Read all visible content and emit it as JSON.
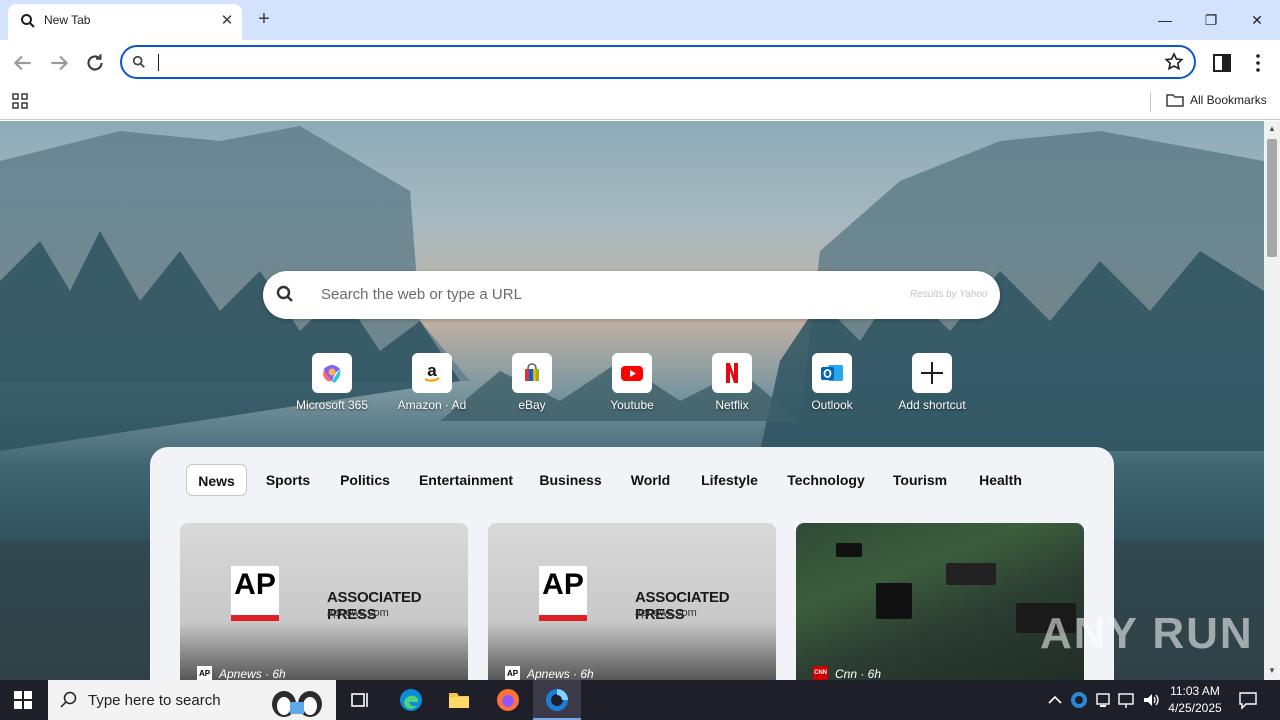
{
  "browser": {
    "tab": {
      "title": "New Tab",
      "icon": "search-icon"
    },
    "window_controls": [
      "minimize-icon",
      "restore-icon",
      "close-icon"
    ],
    "omnibox": {
      "value": "",
      "placeholder": ""
    },
    "bookmarks": {
      "folder_label": "All Bookmarks"
    }
  },
  "page": {
    "search": {
      "placeholder": "Search the web or type a URL",
      "provider": "Results by Yahoo"
    },
    "shortcuts": [
      {
        "label": "Microsoft 365",
        "icon": "microsoft365-icon"
      },
      {
        "label": "Amazon · Ad",
        "icon": "amazon-icon"
      },
      {
        "label": "eBay",
        "icon": "ebay-icon"
      },
      {
        "label": "Youtube",
        "icon": "youtube-icon"
      },
      {
        "label": "Netflix",
        "icon": "netflix-icon"
      },
      {
        "label": "Outlook",
        "icon": "outlook-icon"
      },
      {
        "label": "Add shortcut",
        "icon": "plus-icon"
      }
    ],
    "news": {
      "tabs": [
        "News",
        "Sports",
        "Politics",
        "Entertainment",
        "Business",
        "World",
        "Lifestyle",
        "Technology",
        "Tourism",
        "Health"
      ],
      "active_tab": "News",
      "cards": [
        {
          "logo_text": "AP",
          "publisher": "ASSOCIATED PRESS",
          "url": "apnews.com",
          "source": "Apnews · 6h",
          "badge": "AP"
        },
        {
          "logo_text": "AP",
          "publisher": "ASSOCIATED PRESS",
          "url": "apnews.com",
          "source": "Apnews · 6h",
          "badge": "AP"
        },
        {
          "source": "Cnn · 6h",
          "badge": "CNN"
        }
      ]
    },
    "watermark": "ANY RUN"
  },
  "taskbar": {
    "search_placeholder": "Type here to search",
    "time": "11:03 AM",
    "date": "4/25/2025"
  },
  "colors": {
    "accent": "#0b57d0",
    "tabstrip": "#d3e3fd",
    "taskbar": "#1f1f2a"
  }
}
